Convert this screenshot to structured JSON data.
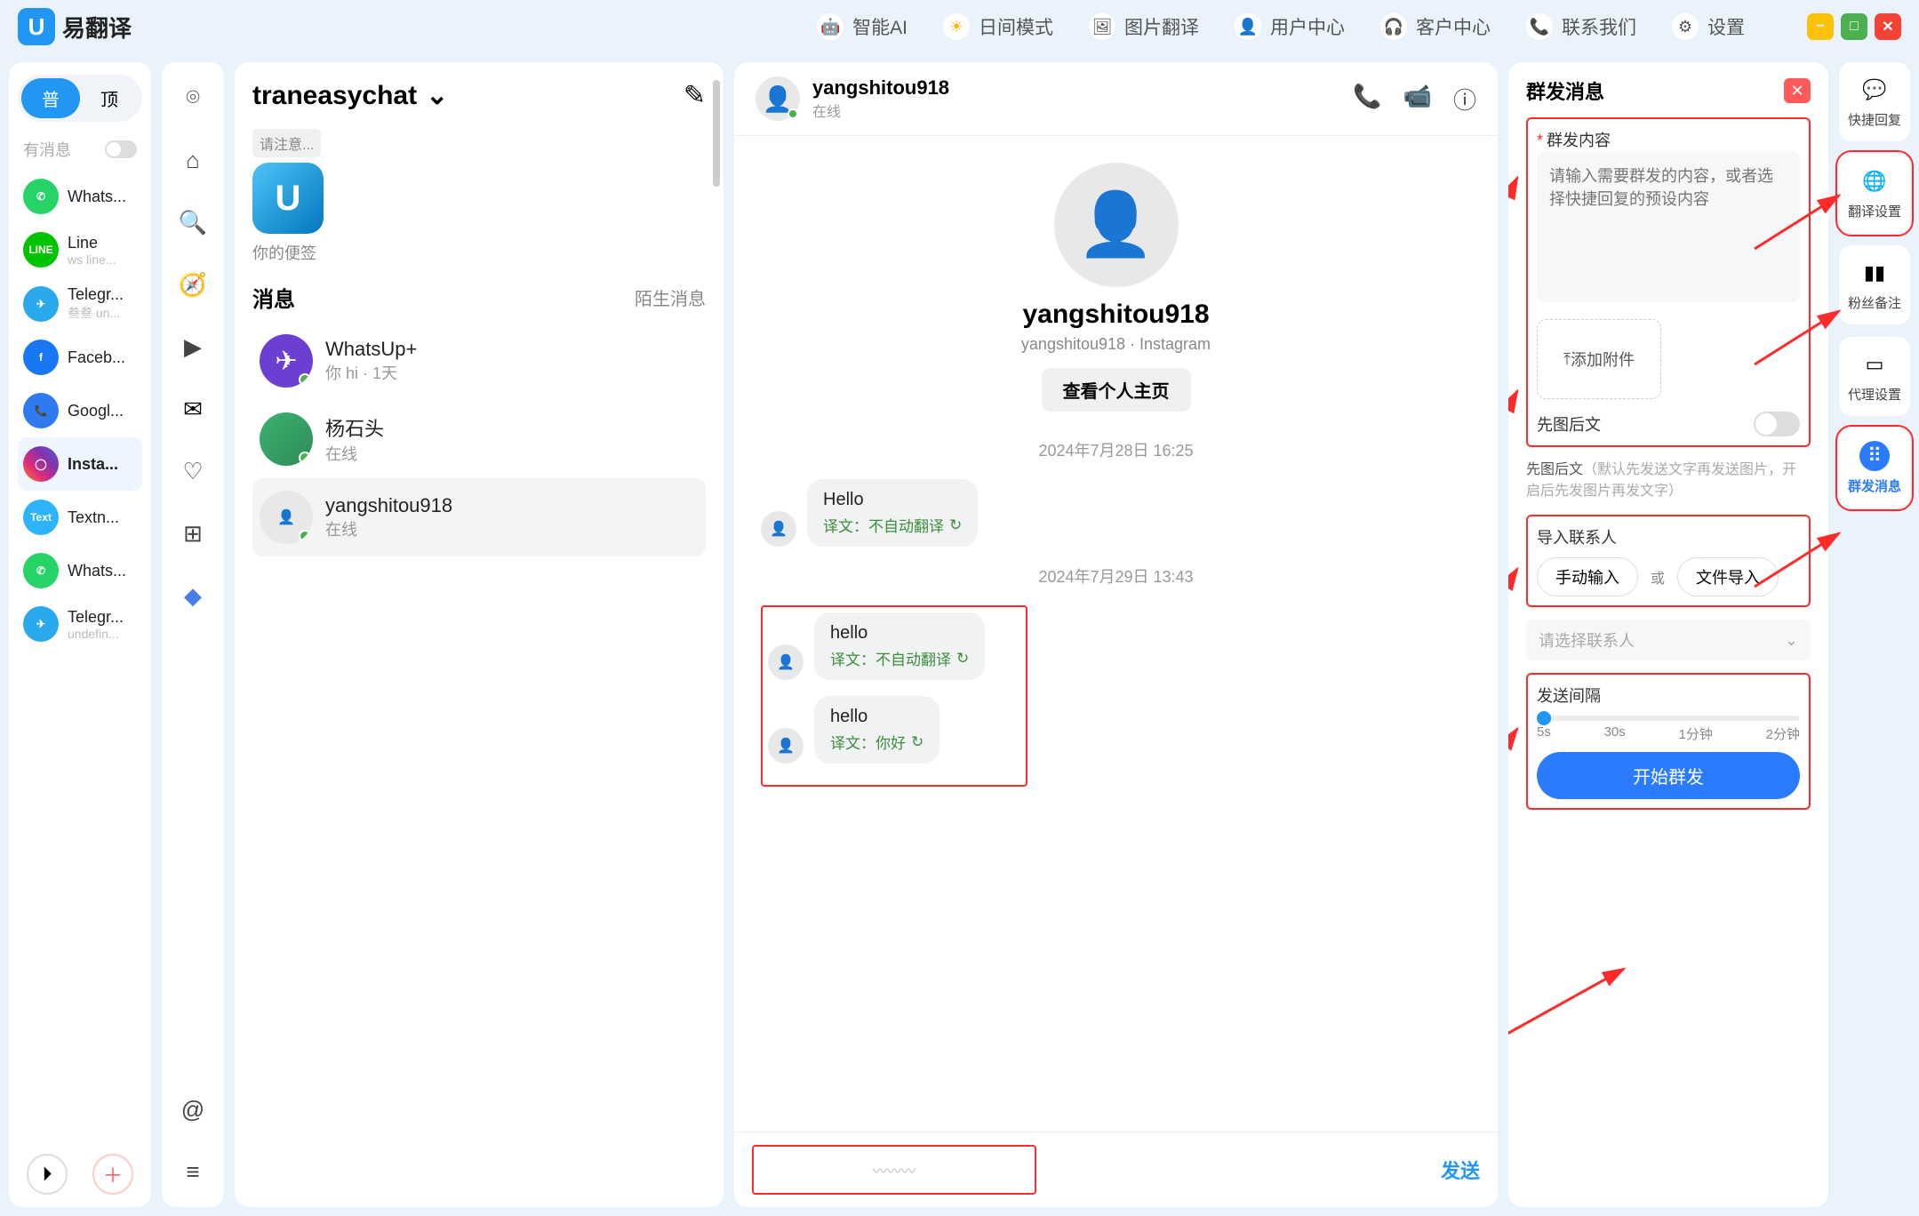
{
  "app": {
    "name": "易翻译"
  },
  "top_menu": {
    "ai": "智能AI",
    "mode": "日间模式",
    "img_trans": "图片翻译",
    "user_center": "用户中心",
    "cust_center": "客户中心",
    "contact": "联系我们",
    "settings": "设置"
  },
  "left_tabs": {
    "pu": "普",
    "ding": "顶"
  },
  "filter": {
    "label": "有消息"
  },
  "accounts": [
    {
      "name": "Whats...",
      "sub": "",
      "color": "#25D366",
      "glyph": "✆"
    },
    {
      "name": "Line",
      "sub": "ws line...",
      "color": "#00C300",
      "glyph": "LINE"
    },
    {
      "name": "Telegr...",
      "sub": "叁叁 un...",
      "color": "#29a9eb",
      "glyph": "✈"
    },
    {
      "name": "Faceb...",
      "sub": "",
      "color": "#1877F2",
      "glyph": "f"
    },
    {
      "name": "Googl...",
      "sub": "",
      "color": "#2d7af1",
      "glyph": "📞"
    },
    {
      "name": "Insta...",
      "sub": "",
      "color": "linear-gradient(45deg,#f58529,#dd2a7b,#8134af,#515bd4)",
      "glyph": "◯",
      "active": true
    },
    {
      "name": "Textn...",
      "sub": "",
      "color": "#2eb4ff",
      "glyph": "Text"
    },
    {
      "name": "Whats...",
      "sub": "",
      "color": "#25D366",
      "glyph": "✆"
    },
    {
      "name": "Telegr...",
      "sub": "undefin...",
      "color": "#29a9eb",
      "glyph": "✈"
    }
  ],
  "convo": {
    "title": "traneasychat",
    "notice_tip": "请注意...",
    "notice_label": "你的便签",
    "section": "消息",
    "stranger": "陌生消息",
    "chats": [
      {
        "name": "WhatsUp+",
        "sub": "你 hi · 1天",
        "avatar_bg": "#6a3fd1"
      },
      {
        "name": "杨石头",
        "sub": "在线",
        "avatar_bg": "photo"
      },
      {
        "name": "yangshitou918",
        "sub": "在线",
        "avatar_bg": "gray",
        "active": true
      }
    ]
  },
  "chat": {
    "name": "yangshitou918",
    "status": "在线",
    "profile_sub": "yangshitou918 · Instagram",
    "profile_btn": "查看个人主页",
    "date1": "2024年7月28日 16:25",
    "date2": "2024年7月29日 13:43",
    "msg1": {
      "text": "Hello",
      "trans": "译文：不自动翻译"
    },
    "msg2": {
      "text": "hello",
      "trans": "译文：不自动翻译"
    },
    "msg3": {
      "text": "hello",
      "trans": "译文：你好"
    },
    "send": "发送"
  },
  "broadcast": {
    "title": "群发消息",
    "content_label": "群发内容",
    "content_placeholder": "请输入需要群发的内容，或者选择快捷回复的预设内容",
    "attach": "添加附件",
    "pic_first": "先图后文",
    "pic_hint_strong": "先图后文",
    "pic_hint_rest": "（默认先发送文字再发送图片，开启后先发图片再发文字）",
    "import_label": "导入联系人",
    "manual": "手动输入",
    "or": "或",
    "file_import": "文件导入",
    "select_placeholder": "请选择联系人",
    "interval_label": "发送间隔",
    "ticks": [
      "5s",
      "30s",
      "1分钟",
      "2分钟"
    ],
    "submit": "开始群发"
  },
  "right_rail": [
    {
      "label": "快捷回复",
      "icon": "💬"
    },
    {
      "label": "翻译设置",
      "icon": "🌐"
    },
    {
      "label": "粉丝备注",
      "icon": "▮▮"
    },
    {
      "label": "代理设置",
      "icon": "▭"
    },
    {
      "label": "群发消息",
      "icon": "⠿",
      "active": true
    }
  ]
}
